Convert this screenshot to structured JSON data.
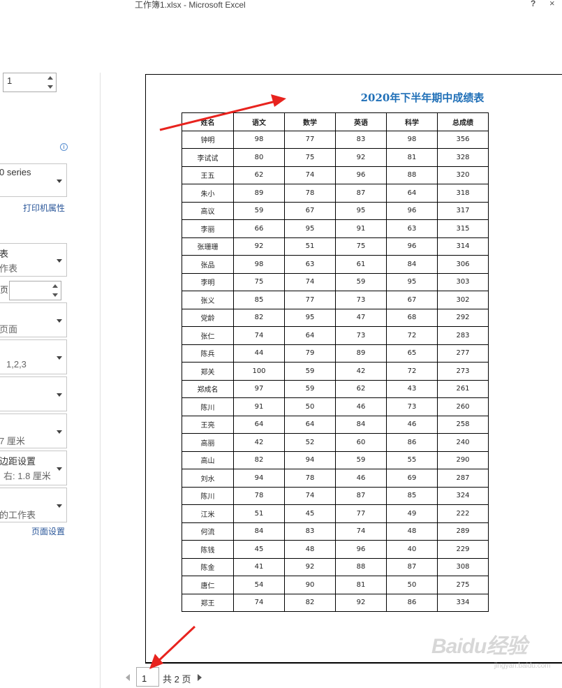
{
  "window": {
    "title": "工作簿1.xlsx - Microsoft Excel",
    "help": "?",
    "close": "×"
  },
  "sidebar": {
    "copies_value": "1",
    "printer": {
      "name_partial": "0 series",
      "properties_link": "打印机属性"
    },
    "what_to_print": {
      "line1": "表",
      "line2": "作表"
    },
    "pages_label": "页",
    "page_range_value": "",
    "sides": {
      "line2": "页面"
    },
    "collation": {
      "line2": "1,2,3"
    },
    "orientation": {
      "line2": ""
    },
    "paper_size": {
      "line2": "7 厘米"
    },
    "margins": {
      "line1": "边距设置",
      "line2": "右: 1.8 厘米"
    },
    "scaling": {
      "line2": "的工作表"
    },
    "page_setup_link": "页面设置"
  },
  "preview": {
    "title": "2020年下半年期中成绩表",
    "headers": [
      "姓名",
      "语文",
      "数学",
      "英语",
      "科学",
      "总成绩"
    ],
    "rows": [
      [
        "钟明",
        "98",
        "77",
        "83",
        "98",
        "356"
      ],
      [
        "李试试",
        "80",
        "75",
        "92",
        "81",
        "328"
      ],
      [
        "王五",
        "62",
        "74",
        "96",
        "88",
        "320"
      ],
      [
        "朱小",
        "89",
        "78",
        "87",
        "64",
        "318"
      ],
      [
        "高议",
        "59",
        "67",
        "95",
        "96",
        "317"
      ],
      [
        "李丽",
        "66",
        "95",
        "91",
        "63",
        "315"
      ],
      [
        "张珊珊",
        "92",
        "51",
        "75",
        "96",
        "314"
      ],
      [
        "张品",
        "98",
        "63",
        "61",
        "84",
        "306"
      ],
      [
        "李明",
        "75",
        "74",
        "59",
        "95",
        "303"
      ],
      [
        "张义",
        "85",
        "77",
        "73",
        "67",
        "302"
      ],
      [
        "党龄",
        "82",
        "95",
        "47",
        "68",
        "292"
      ],
      [
        "张仁",
        "74",
        "64",
        "73",
        "72",
        "283"
      ],
      [
        "陈兵",
        "44",
        "79",
        "89",
        "65",
        "277"
      ],
      [
        "郑关",
        "100",
        "59",
        "42",
        "72",
        "273"
      ],
      [
        "郑成名",
        "97",
        "59",
        "62",
        "43",
        "261"
      ],
      [
        "陈川",
        "91",
        "50",
        "46",
        "73",
        "260"
      ],
      [
        "王亮",
        "64",
        "64",
        "84",
        "46",
        "258"
      ],
      [
        "高丽",
        "42",
        "52",
        "60",
        "86",
        "240"
      ],
      [
        "高山",
        "82",
        "94",
        "59",
        "55",
        "290"
      ],
      [
        "刘水",
        "94",
        "78",
        "46",
        "69",
        "287"
      ],
      [
        "陈川",
        "78",
        "74",
        "87",
        "85",
        "324"
      ],
      [
        "江米",
        "51",
        "45",
        "77",
        "49",
        "222"
      ],
      [
        "何流",
        "84",
        "83",
        "74",
        "48",
        "289"
      ],
      [
        "陈钱",
        "45",
        "48",
        "96",
        "40",
        "229"
      ],
      [
        "陈金",
        "41",
        "92",
        "88",
        "87",
        "308"
      ],
      [
        "唐仁",
        "54",
        "90",
        "81",
        "50",
        "275"
      ],
      [
        "郑王",
        "74",
        "82",
        "92",
        "86",
        "334"
      ]
    ]
  },
  "pager": {
    "current_page": "1",
    "total_text": "共 2 页"
  },
  "watermark": {
    "brand": "Baidu经验",
    "url": "jingyan.baidu.com"
  },
  "colors": {
    "title_blue": "#1f6fb7",
    "annotation_red": "#e8231e",
    "link_blue": "#2b579a"
  }
}
